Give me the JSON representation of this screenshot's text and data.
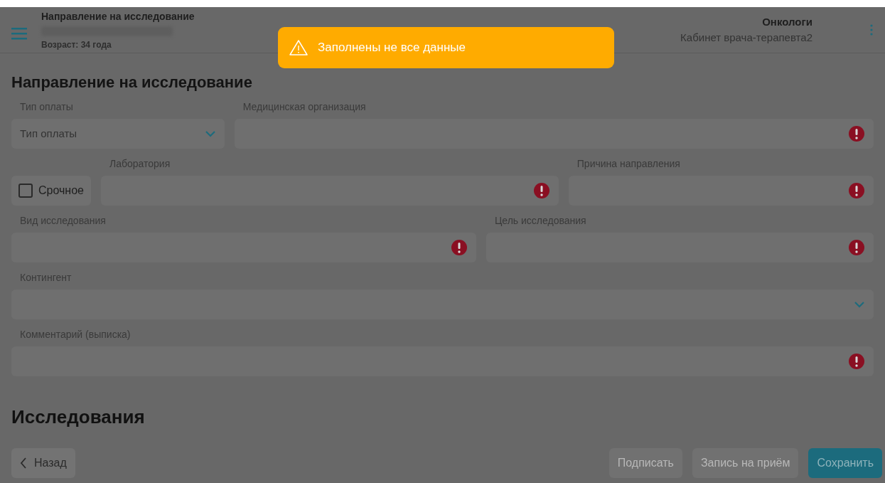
{
  "header": {
    "title": "Направление на исследование",
    "age": "Возраст: 34 года",
    "department": "Онкологи",
    "cabinet": "Кабинет врача-терапевта2"
  },
  "toast": {
    "kind": "warning",
    "message": "Заполнены не все данные"
  },
  "form": {
    "title": "Направление на исследование",
    "rows": [
      [
        {
          "kind": "select",
          "label": "Тип оплаты",
          "placeholder": "Тип оплаты",
          "error": false
        },
        {
          "kind": "input",
          "label": "Медицинская организация",
          "error": true
        }
      ],
      [
        {
          "kind": "checkbox",
          "label": "Срочное",
          "checked": false
        },
        {
          "kind": "input",
          "label": "Лаборатория",
          "error": true
        },
        {
          "kind": "input",
          "label": "Причина направления",
          "error": true
        }
      ],
      [
        {
          "kind": "input",
          "label": "Вид исследования",
          "error": true
        },
        {
          "kind": "input",
          "label": "Цель исследования",
          "error": true
        }
      ],
      [
        {
          "kind": "select",
          "label": "Контингент",
          "error": false
        }
      ],
      [
        {
          "kind": "input",
          "label": "Комментарий (выписка)",
          "error": true
        }
      ]
    ]
  },
  "section_title": "Исследования",
  "footer": [
    {
      "kind": "back",
      "label": "Назад",
      "disabled": false
    },
    {
      "kind": "plain",
      "label": "Подписать",
      "disabled": true
    },
    {
      "kind": "plain",
      "label": "Запись на приём",
      "disabled": true
    },
    {
      "kind": "primary",
      "label": "Сохранить",
      "disabled": false
    }
  ]
}
